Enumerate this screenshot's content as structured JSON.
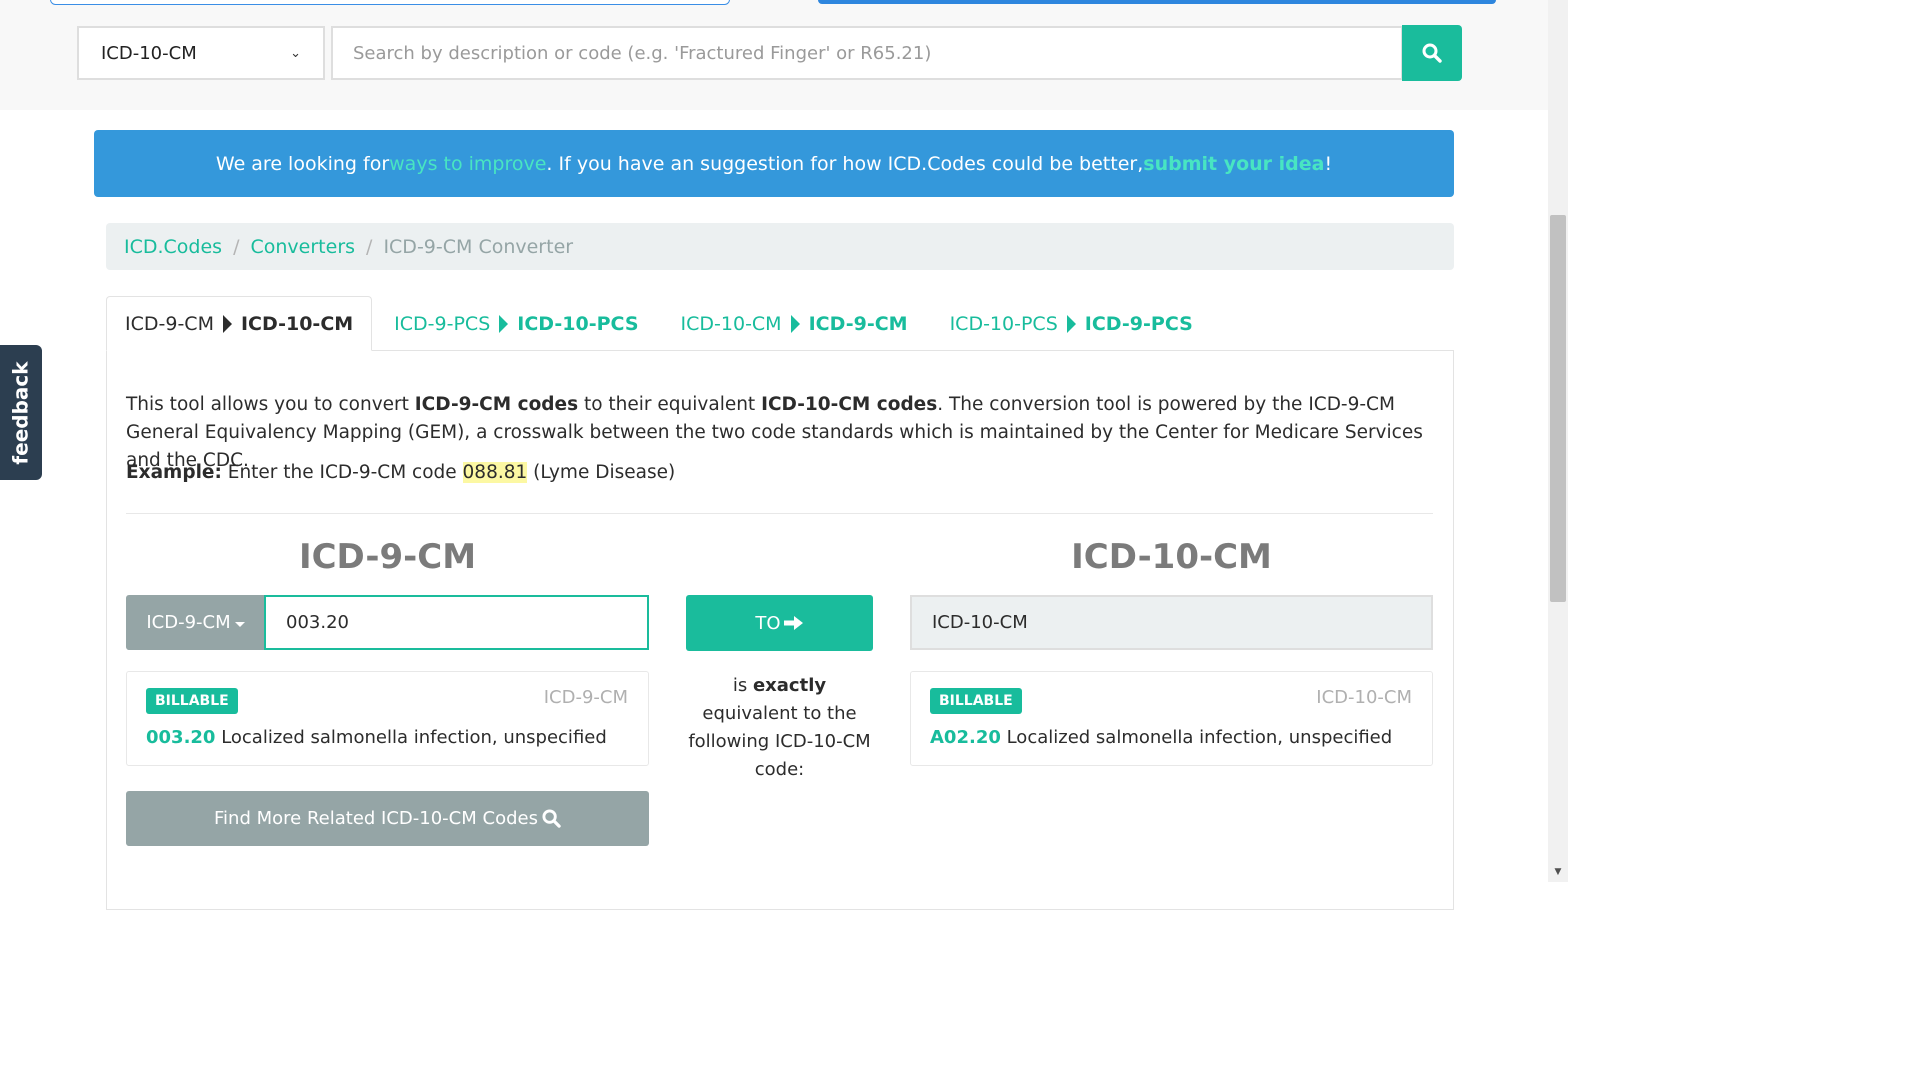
{
  "search": {
    "code_system": "ICD-10-CM",
    "placeholder": "Search by description or code (e.g. 'Fractured Finger' or R65.21)"
  },
  "banner": {
    "pre": "We are looking for ",
    "link1": "ways to improve",
    "mid": ". If you have an suggestion for how ICD.Codes could be better, ",
    "link2": "submit your idea",
    "post": "!"
  },
  "breadcrumb": {
    "home": "ICD.Codes",
    "section": "Converters",
    "current": "ICD-9-CM Converter"
  },
  "tabs": [
    {
      "from": "ICD-9-CM",
      "to": "ICD-10-CM",
      "active": true
    },
    {
      "from": "ICD-9-PCS",
      "to": "ICD-10-PCS",
      "active": false
    },
    {
      "from": "ICD-10-CM",
      "to": "ICD-9-CM",
      "active": false
    },
    {
      "from": "ICD-10-PCS",
      "to": "ICD-9-PCS",
      "active": false
    }
  ],
  "description": {
    "p1": "This tool allows you to convert ",
    "b1": "ICD-9-CM codes",
    "p2": " to their equivalent ",
    "b2": "ICD-10-CM codes",
    "p3": ". The conversion tool is powered by the ICD-9-CM General Equivalency Mapping (GEM), a crosswalk between the two code standards which is maintained by the Center for Medicare Services and the CDC."
  },
  "example": {
    "label": "Example:",
    "pre": " Enter the ICD-9-CM code ",
    "code": "088.81",
    "post": " (Lyme Disease)"
  },
  "converter": {
    "source_heading": "ICD-9-CM",
    "target_heading": "ICD-10-CM",
    "source_system": "ICD-9-CM",
    "source_code": "003.20",
    "to_label": "TO",
    "target_system": "ICD-10-CM",
    "middle_pre": "is ",
    "middle_bold": "exactly",
    "middle_post": " equivalent to the following ICD-10-CM code:",
    "source_result": {
      "badge": "BILLABLE",
      "system": "ICD-9-CM",
      "code": "003.20",
      "description": " Localized salmonella infection, unspecified"
    },
    "target_result": {
      "badge": "BILLABLE",
      "system": "ICD-10-CM",
      "code": "A02.20",
      "description": " Localized salmonella infection, unspecified"
    },
    "more_button": "Find More Related ICD-10-CM Codes"
  },
  "feedback_label": "feedback",
  "colors": {
    "accent": "#1abc9c",
    "banner": "#3498db",
    "muted_button": "#95a5a6",
    "feedback_tab": "#2c3e50"
  },
  "icons": {
    "search": "search-icon",
    "arrow": "arrow-right-icon",
    "tab_triangle": "triangle-right-icon"
  }
}
